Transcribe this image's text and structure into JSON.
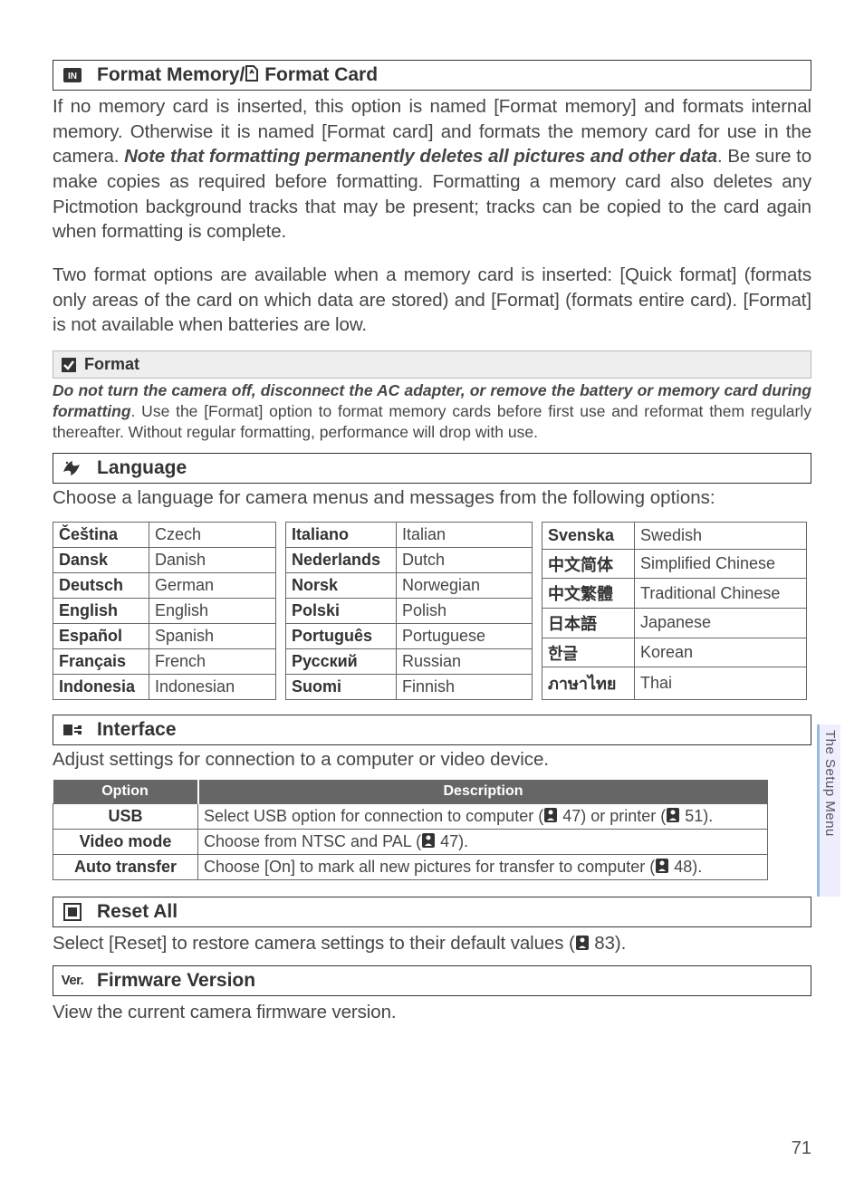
{
  "sections": {
    "format": {
      "title": "Format Memory/",
      "title2": " Format Card",
      "p1a": "If no memory card is inserted, this option is named [Format memory] and formats internal memory.  Otherwise it is named [Format card] and formats the memory card for use in the camera.  ",
      "p1b": "Note that formatting permanently deletes all pictures and other data",
      "p1c": ".  Be sure to make copies as required before formatting.  Formatting a memory card also deletes any Pictmotion background tracks that may be present; tracks can be copied to the card again when formatting is complete.",
      "p2": "Two format options are available when a memory card is inserted: [Quick format] (formats only areas of the card on which data are stored) and [Format] (formats entire card).  [Format] is not available when batteries are low.",
      "note_title": "Format",
      "note_a": "Do not turn the camera off, disconnect the AC adapter, or remove the battery or memory card during formatting",
      "note_b": ".  Use the [Format] option to format memory cards before first use and reformat them regularly thereafter.  Without regular formatting, performance will drop with use."
    },
    "language": {
      "title": "Language",
      "intro": "Choose a language for camera menus and messages from the following options:",
      "col1": [
        {
          "n": "Čeština",
          "e": "Czech"
        },
        {
          "n": "Dansk",
          "e": "Danish"
        },
        {
          "n": "Deutsch",
          "e": "German"
        },
        {
          "n": "English",
          "e": "English"
        },
        {
          "n": "Español",
          "e": "Spanish"
        },
        {
          "n": "Français",
          "e": "French"
        },
        {
          "n": "Indonesia",
          "e": "Indonesian"
        }
      ],
      "col2": [
        {
          "n": "Italiano",
          "e": "Italian"
        },
        {
          "n": "Nederlands",
          "e": "Dutch"
        },
        {
          "n": "Norsk",
          "e": "Norwegian"
        },
        {
          "n": "Polski",
          "e": "Polish"
        },
        {
          "n": "Português",
          "e": "Portuguese"
        },
        {
          "n": "Русский",
          "e": "Russian"
        },
        {
          "n": "Suomi",
          "e": "Finnish"
        }
      ],
      "col3": [
        {
          "n": "Svenska",
          "e": "Swedish"
        },
        {
          "n": "中文简体",
          "e": "Simplified Chinese"
        },
        {
          "n": "中文繁體",
          "e": "Traditional Chinese"
        },
        {
          "n": "日本語",
          "e": "Japanese"
        },
        {
          "n": "한글",
          "e": "Korean"
        },
        {
          "n": "ภาษาไทย",
          "e": "Thai"
        }
      ]
    },
    "interface": {
      "title": "Interface",
      "intro": "Adjust settings for connection to a computer or video device.",
      "header_option": "Option",
      "header_desc": "Description",
      "rows": [
        {
          "opt": "USB",
          "d1": "Select USB option for connection to computer (",
          "r1": " 47) or printer (",
          "r2": " 51)."
        },
        {
          "opt": "Video mode",
          "d1": "Choose from NTSC and PAL (",
          "r1": " 47).",
          "r2": ""
        },
        {
          "opt": "Auto transfer",
          "d1": "Choose [On] to mark all new pictures for transfer to computer (",
          "r1": " 48).",
          "r2": ""
        }
      ]
    },
    "reset": {
      "title": "Reset All",
      "text_a": "Select [Reset] to restore camera settings to their default values (",
      "text_b": " 83)."
    },
    "firmware": {
      "title": "Firmware Version",
      "text": "View the current camera firmware version."
    }
  },
  "side_tab": "The Setup Menu",
  "page_number": "71"
}
